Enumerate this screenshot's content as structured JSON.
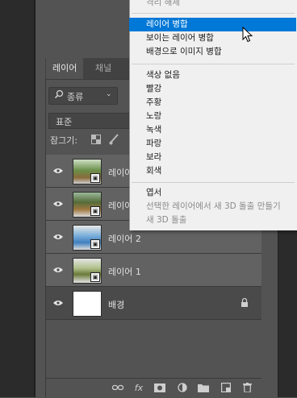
{
  "tabs": [
    {
      "label": "레이어",
      "active": true
    },
    {
      "label": "채널",
      "active": false
    }
  ],
  "filter": {
    "label": "종류"
  },
  "blend_mode": {
    "value": "표준"
  },
  "lock": {
    "label": "잠그기:"
  },
  "layers": [
    {
      "name": "레이어",
      "thumb": "photo-b"
    },
    {
      "name": "레이어",
      "thumb": "photo-a"
    },
    {
      "name": "레이어 2",
      "thumb": "sky"
    },
    {
      "name": "레이어 1",
      "thumb": "photo-c"
    },
    {
      "name": "배경",
      "thumb": "white"
    }
  ],
  "menu": {
    "items": [
      {
        "label": "격리 해제",
        "state": "partial"
      },
      {
        "label": "레이어 병합",
        "state": "highlighted"
      },
      {
        "label": "보이는 레이어 병합",
        "state": "normal"
      },
      {
        "label": "배경으로 이미지 병합",
        "state": "normal"
      },
      {
        "label": "색상 없음",
        "state": "normal"
      },
      {
        "label": "빨강",
        "state": "normal"
      },
      {
        "label": "주황",
        "state": "normal"
      },
      {
        "label": "노랑",
        "state": "normal"
      },
      {
        "label": "녹색",
        "state": "normal"
      },
      {
        "label": "파랑",
        "state": "normal"
      },
      {
        "label": "보라",
        "state": "normal"
      },
      {
        "label": "회색",
        "state": "normal"
      },
      {
        "label": "엽서",
        "state": "normal"
      },
      {
        "label": "선택한 레이어에서 새 3D 돌출 만들기",
        "state": "disabled"
      },
      {
        "label": "새 3D 돌출",
        "state": "disabled"
      }
    ]
  },
  "colors": {
    "highlight": "#0078d7",
    "panel": "#535353",
    "menu_bg": "#f0f0f0"
  }
}
